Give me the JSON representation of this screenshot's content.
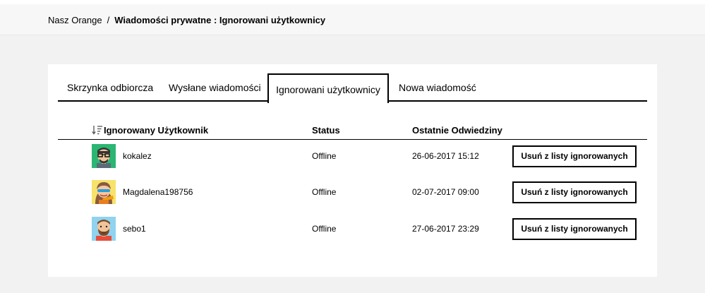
{
  "breadcrumb": {
    "home": "Nasz Orange",
    "separator": "/",
    "current": "Wiadomości prywatne : Ignorowani użytkownicy"
  },
  "tabs": [
    {
      "label": "Skrzynka odbiorcza",
      "active": false
    },
    {
      "label": "Wysłane wiadomości",
      "active": false
    },
    {
      "label": "Ignorowani użytkownicy",
      "active": true
    },
    {
      "label": "Nowa wiadomość",
      "active": false
    }
  ],
  "table": {
    "columns": {
      "user": "Ignorowany Użytkownik",
      "status": "Status",
      "last_visit": "Ostatnie Odwiedziny"
    },
    "sort_icon": "sort-descending-icon",
    "rows": [
      {
        "username": "kokalez",
        "status": "Offline",
        "last_visit": "26-06-2017 15:12",
        "action": "Usuń z listy ignorowanych",
        "avatar": "avatar-glasses-man"
      },
      {
        "username": "Magdalena198756",
        "status": "Offline",
        "last_visit": "02-07-2017 09:00",
        "action": "Usuń z listy ignorowanych",
        "avatar": "avatar-woman-sunglasses"
      },
      {
        "username": "sebo1",
        "status": "Offline",
        "last_visit": "27-06-2017 23:29",
        "action": "Usuń z listy ignorowanych",
        "avatar": "avatar-bearded-man"
      }
    ]
  },
  "colors": {
    "page_background": "#f2f2f2",
    "card_background": "#ffffff",
    "border": "#000000"
  }
}
